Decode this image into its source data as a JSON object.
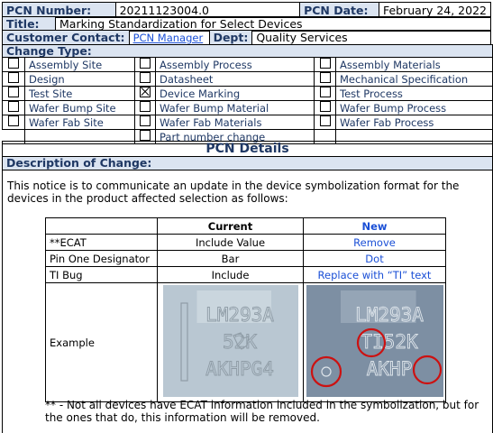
{
  "header": {
    "pcn_number_label": "PCN Number:",
    "pcn_number": "20211123004.0",
    "pcn_date_label": "PCN Date:",
    "pcn_date": "February 24, 2022",
    "title_label": "Title:",
    "title": "Marking Standardization for Select Devices",
    "contact_label": "Customer Contact:",
    "contact_link": "PCN Manager",
    "dept_label": "Dept:",
    "dept": "Quality Services"
  },
  "change_type": {
    "label": "Change Type:",
    "rows": [
      [
        {
          "label": "Assembly Site",
          "checked": false
        },
        {
          "label": "Assembly Process",
          "checked": false
        },
        {
          "label": "Assembly Materials",
          "checked": false
        }
      ],
      [
        {
          "label": "Design",
          "checked": false
        },
        {
          "label": "Datasheet",
          "checked": false
        },
        {
          "label": "Mechanical Specification",
          "checked": false
        }
      ],
      [
        {
          "label": "Test Site",
          "checked": false
        },
        {
          "label": "Device Marking",
          "checked": true
        },
        {
          "label": "Test Process",
          "checked": false
        }
      ],
      [
        {
          "label": "Wafer Bump Site",
          "checked": false
        },
        {
          "label": "Wafer Bump Material",
          "checked": false
        },
        {
          "label": "Wafer Bump Process",
          "checked": false
        }
      ],
      [
        {
          "label": "Wafer Fab Site",
          "checked": false
        },
        {
          "label": "Wafer Fab Materials",
          "checked": false
        },
        {
          "label": "Wafer Fab Process",
          "checked": false
        }
      ],
      [
        null,
        {
          "label": "Part number change",
          "checked": false
        },
        null
      ]
    ]
  },
  "details": {
    "heading": "PCN Details",
    "desc_label": "Description of Change:",
    "intro": "This notice is to communicate an update in the device symbolization format for the devices in the product affected selection as follows:",
    "footnote": "** - Not all devices have ECAT information included in the symbolization, but for the ones that do, this information will be removed."
  },
  "compare": {
    "headers": [
      "",
      "Current",
      "New"
    ],
    "rows": [
      [
        "**ECAT",
        "Include Value",
        "Remove"
      ],
      [
        "Pin One Designator",
        "Bar",
        "Dot"
      ],
      [
        "TI Bug",
        "Include",
        "Replace with “TI” text"
      ]
    ],
    "example_label": "Example",
    "current_marking": [
      "LM293A",
      "52K",
      "AKHPG4"
    ],
    "new_marking": [
      "LM293A",
      "TI52K",
      "AKHP"
    ]
  },
  "colors": {
    "header_bg": "#dbe4f1",
    "header_text": "#1f3864",
    "link_blue": "#1a4fd6",
    "circle_red": "#cc1111"
  }
}
